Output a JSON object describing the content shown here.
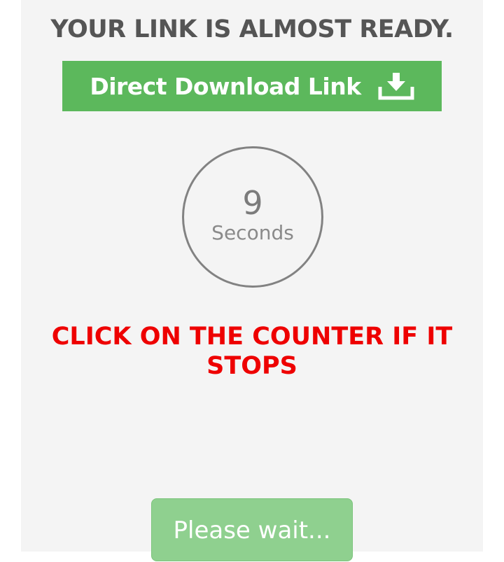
{
  "header": {
    "title": "YOUR LINK IS ALMOST READY."
  },
  "download_banner": {
    "label": "Direct Download Link",
    "icon": "download-tray-icon"
  },
  "countdown": {
    "value": "9",
    "unit": "Seconds"
  },
  "notice": {
    "text": "CLICK ON THE COUNTER IF IT STOPS"
  },
  "wait_button": {
    "label": "Please wait..."
  },
  "colors": {
    "background": "#f4f4f4",
    "banner_green": "#5cb85c",
    "button_green": "#8fd08f",
    "alert_red": "#ee0000",
    "heading_gray": "#555555"
  }
}
